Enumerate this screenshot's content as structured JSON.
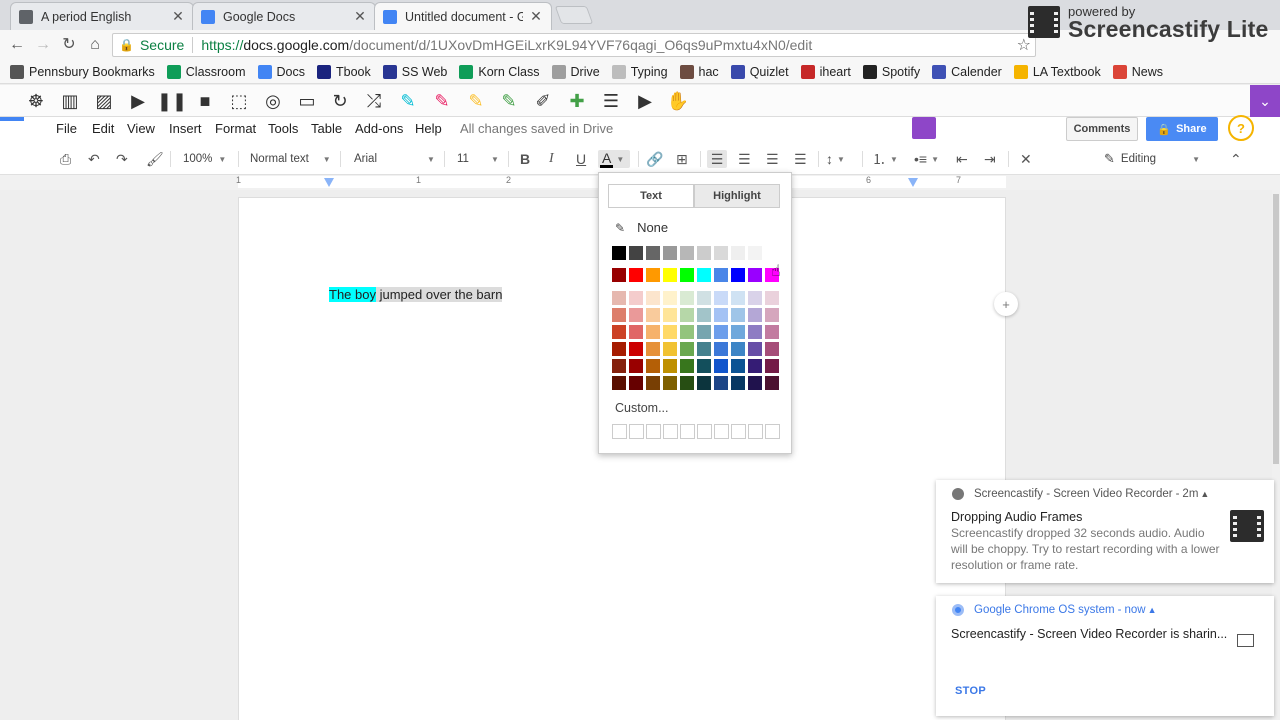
{
  "tabs": [
    {
      "title": "A period English",
      "color": "#5f6368",
      "active": false
    },
    {
      "title": "Google Docs",
      "color": "#4285f4",
      "active": false
    },
    {
      "title": "Untitled document - Goo",
      "color": "#4285f4",
      "active": true
    }
  ],
  "address": {
    "secure_label": "Secure",
    "scheme": "https://",
    "host": "docs.google.com",
    "path": "/document/d/1UXovDmHGEiLxrK9L94YVF76qagi_O6qs9uPmxtu4xN0/edit"
  },
  "bookmarks": [
    {
      "label": "Pennsbury Bookmarks",
      "color": "#555555"
    },
    {
      "label": "Classroom",
      "color": "#0f9d58"
    },
    {
      "label": "Docs",
      "color": "#4285f4"
    },
    {
      "label": "Tbook",
      "color": "#1a237e"
    },
    {
      "label": "SS Web",
      "color": "#283593"
    },
    {
      "label": "Korn Class",
      "color": "#0f9d58"
    },
    {
      "label": "Drive",
      "color": "#9e9e9e"
    },
    {
      "label": "Typing",
      "color": "#bdbdbd"
    },
    {
      "label": "hac",
      "color": "#6d4c41"
    },
    {
      "label": "Quizlet",
      "color": "#3949ab"
    },
    {
      "label": "iheart",
      "color": "#c62828"
    },
    {
      "label": "Spotify",
      "color": "#222222"
    },
    {
      "label": "Calender",
      "color": "#3f51b5"
    },
    {
      "label": "LA Textbook",
      "color": "#f5b400"
    },
    {
      "label": "News",
      "color": "#db4437"
    }
  ],
  "screencastify": {
    "powered_by": "powered by",
    "brand": "Screencastify Lite"
  },
  "docs_menu": {
    "items": [
      "File",
      "Edit",
      "View",
      "Insert",
      "Format",
      "Tools",
      "Table",
      "Add-ons",
      "Help"
    ],
    "save_status": "All changes saved in Drive",
    "comments_label": "Comments",
    "share_label": "Share"
  },
  "format_toolbar": {
    "zoom": "100%",
    "style": "Normal text",
    "font": "Arial",
    "size": "11",
    "mode": "Editing"
  },
  "ruler_numbers": [
    "1",
    "1",
    "2",
    "6",
    "7"
  ],
  "document": {
    "highlighted_text": "The boy",
    "rest_text": " jumped over the barn"
  },
  "color_picker": {
    "tab_text": "Text",
    "tab_highlight": "Highlight",
    "none_label": "None",
    "custom_label": "Custom...",
    "grays": [
      "#000000",
      "#434343",
      "#666666",
      "#999999",
      "#b7b7b7",
      "#cccccc",
      "#d9d9d9",
      "#efefef",
      "#f3f3f3",
      "#ffffff"
    ],
    "brights": [
      "#980000",
      "#ff0000",
      "#ff9900",
      "#ffff00",
      "#00ff00",
      "#00ffff",
      "#4a86e8",
      "#0000ff",
      "#9900ff",
      "#ff00ff"
    ],
    "shades": [
      [
        "#e6b8af",
        "#f4cccc",
        "#fce5cd",
        "#fff2cc",
        "#d9ead3",
        "#d0e0e3",
        "#c9daf8",
        "#cfe2f3",
        "#d9d2e9",
        "#ead1dc"
      ],
      [
        "#dd7e6b",
        "#ea9999",
        "#f9cb9c",
        "#ffe599",
        "#b6d7a8",
        "#a2c4c9",
        "#a4c2f4",
        "#9fc5e8",
        "#b4a7d6",
        "#d5a6bd"
      ],
      [
        "#cc4125",
        "#e06666",
        "#f6b26b",
        "#ffd966",
        "#93c47d",
        "#76a5af",
        "#6d9eeb",
        "#6fa8dc",
        "#8e7cc3",
        "#c27ba0"
      ],
      [
        "#a61c00",
        "#cc0000",
        "#e69138",
        "#f1c232",
        "#6aa84f",
        "#45818e",
        "#3c78d8",
        "#3d85c6",
        "#674ea7",
        "#a64d79"
      ],
      [
        "#85200c",
        "#990000",
        "#b45f06",
        "#bf9000",
        "#38761d",
        "#134f5c",
        "#1155cc",
        "#0b5394",
        "#351c75",
        "#741b47"
      ],
      [
        "#5b0f00",
        "#660000",
        "#783f04",
        "#7f6000",
        "#274e13",
        "#0c343d",
        "#1c4587",
        "#073763",
        "#20124d",
        "#4c1130"
      ]
    ]
  },
  "notifications": [
    {
      "source": "Screencastify - Screen Video Recorder",
      "time": "2m",
      "title": "Dropping Audio Frames",
      "body": "Screencastify dropped 32 seconds audio. Audio will be choppy. Try to restart recording with a lower resolution or frame rate."
    },
    {
      "source": "Google Chrome OS system",
      "time": "now",
      "body": "Screencastify - Screen Video Recorder is sharin...",
      "action": "STOP"
    }
  ]
}
